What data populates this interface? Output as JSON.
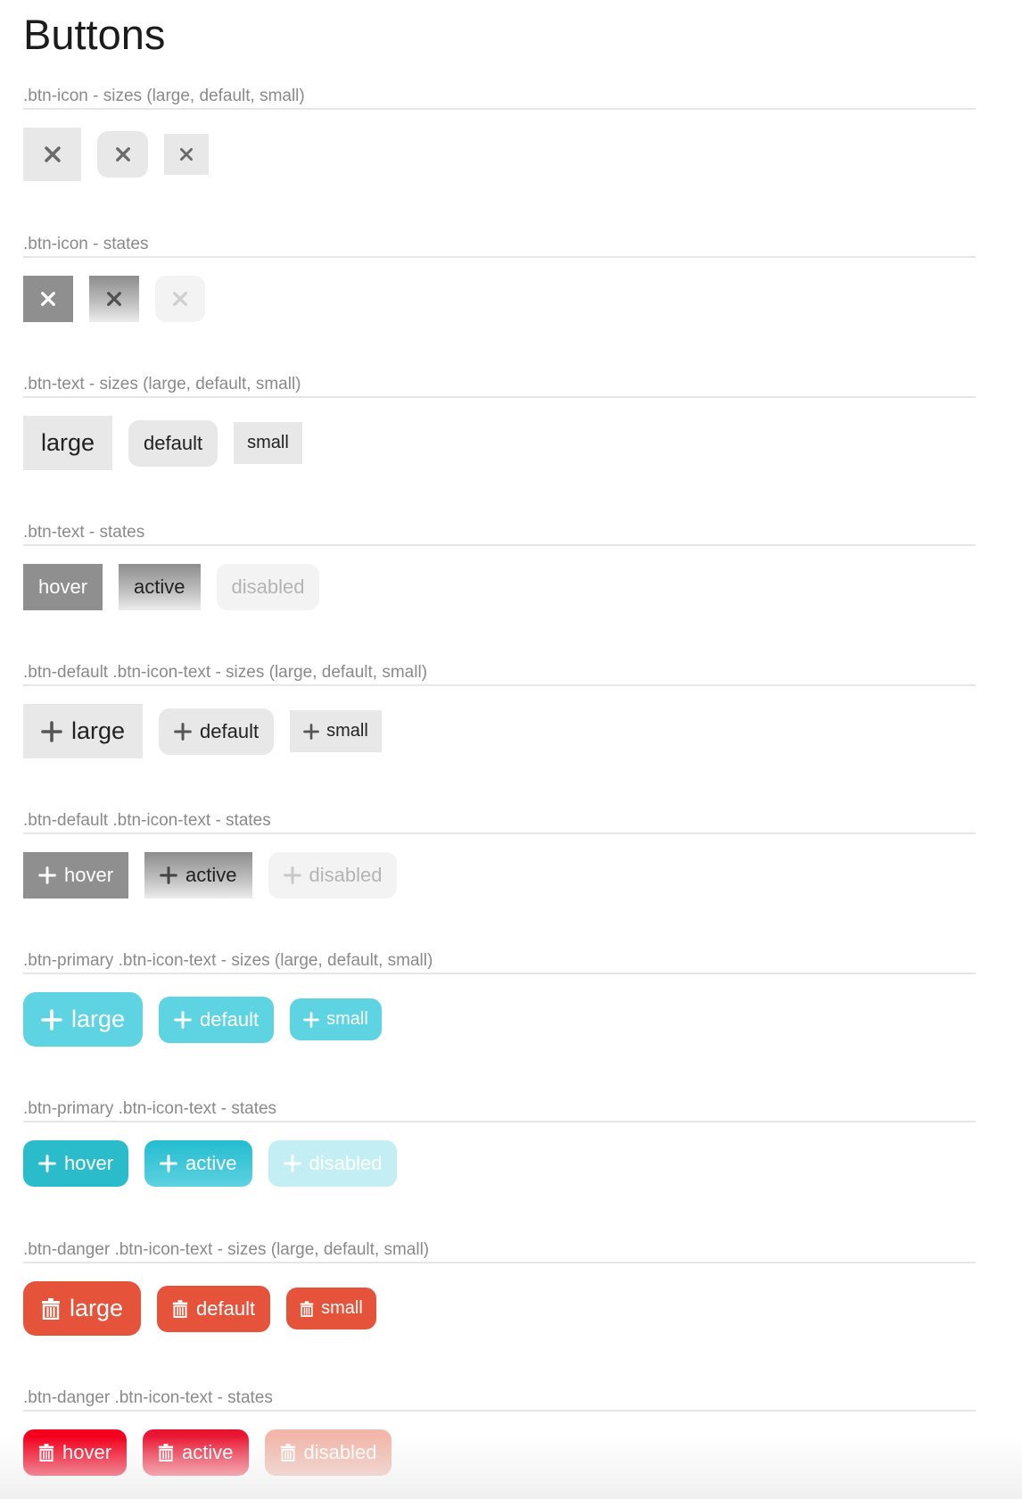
{
  "page": {
    "title": "Buttons"
  },
  "icons": {
    "close": "close-icon",
    "plus": "plus-icon",
    "trash": "trash-icon"
  },
  "colors": {
    "neutral": "#e8e8e8",
    "neutral_hover": "#8f8f8f",
    "primary": "#5ed3e2",
    "primary_hover": "#2bbccc",
    "danger": "#e5533a",
    "danger_hover": "#f2001e"
  },
  "sections": [
    {
      "label": ".btn-icon - sizes (large, default, small)"
    },
    {
      "label": ".btn-icon - states"
    },
    {
      "label": ".btn-text - sizes (large, default, small)",
      "buttons": [
        "large",
        "default",
        "small"
      ]
    },
    {
      "label": ".btn-text - states",
      "buttons": [
        "hover",
        "active",
        "disabled"
      ]
    },
    {
      "label": ".btn-default .btn-icon-text - sizes (large, default, small)",
      "buttons": [
        "large",
        "default",
        "small"
      ]
    },
    {
      "label": ".btn-default .btn-icon-text - states",
      "buttons": [
        "hover",
        "active",
        "disabled"
      ]
    },
    {
      "label": ".btn-primary .btn-icon-text - sizes (large, default, small)",
      "buttons": [
        "large",
        "default",
        "small"
      ]
    },
    {
      "label": ".btn-primary .btn-icon-text - states",
      "buttons": [
        "hover",
        "active",
        "disabled"
      ]
    },
    {
      "label": ".btn-danger .btn-icon-text - sizes (large, default, small)",
      "buttons": [
        "large",
        "default",
        "small"
      ]
    },
    {
      "label": ".btn-danger .btn-icon-text - states",
      "buttons": [
        "hover",
        "active",
        "disabled"
      ]
    }
  ]
}
